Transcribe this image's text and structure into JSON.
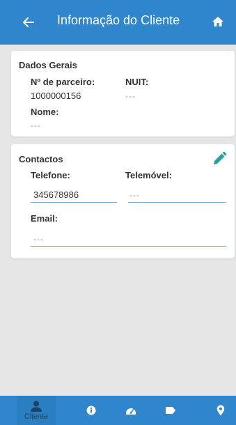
{
  "header": {
    "title": "Informação do Cliente",
    "back_icon": "arrow-left-icon",
    "home_icon": "home-icon",
    "color": "#2f86cc"
  },
  "dados_gerais": {
    "section_title": "Dados Gerais",
    "parceiro_label": "Nº de parceiro:",
    "parceiro_value": "1000000156",
    "nuit_label": "NUIT:",
    "nuit_value": "---",
    "nome_label": "Nome:",
    "nome_value": "---"
  },
  "contactos": {
    "section_title": "Contactos",
    "edit_icon": "pencil-icon",
    "telefone_label": "Telefone:",
    "telefone_value": "345678986",
    "telemovel_label": "Telemóvel:",
    "telemovel_placeholder": "---",
    "email_label": "Email:",
    "email_placeholder": "---"
  },
  "bottom_nav": {
    "items": [
      {
        "label": "Cliente",
        "icon": "person-icon",
        "active": true
      },
      {
        "label": "",
        "icon": "info-icon",
        "active": false
      },
      {
        "label": "",
        "icon": "speedometer-icon",
        "active": false
      },
      {
        "label": "",
        "icon": "label-tag-icon",
        "active": false
      },
      {
        "label": "",
        "icon": "location-pin-icon",
        "active": false
      }
    ]
  }
}
